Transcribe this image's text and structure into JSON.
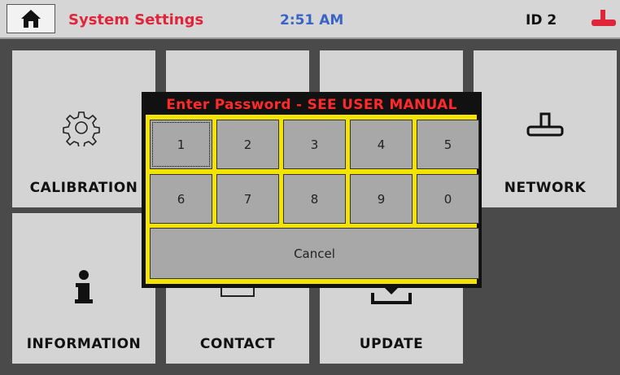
{
  "header": {
    "title": "System Settings",
    "time": "2:51 AM",
    "id_label": "ID 2",
    "home_icon": "home-icon",
    "network_status_icon": "network-icon",
    "colors": {
      "title": "#e0243a",
      "time": "#3a63c8",
      "network_status": "#e0243a"
    }
  },
  "tiles": {
    "calibration": "CALIBRATION",
    "network": "NETWORK",
    "information": "INFORMATION",
    "contact": "CONTACT",
    "update": "UPDATE"
  },
  "password_dialog": {
    "title": "Enter Password - SEE USER MANUAL",
    "keys": [
      "1",
      "2",
      "3",
      "4",
      "5",
      "6",
      "7",
      "8",
      "9",
      "0"
    ],
    "cancel_label": "Cancel",
    "colors": {
      "title": "#ff2a2a",
      "frame": "#f2e300"
    }
  }
}
